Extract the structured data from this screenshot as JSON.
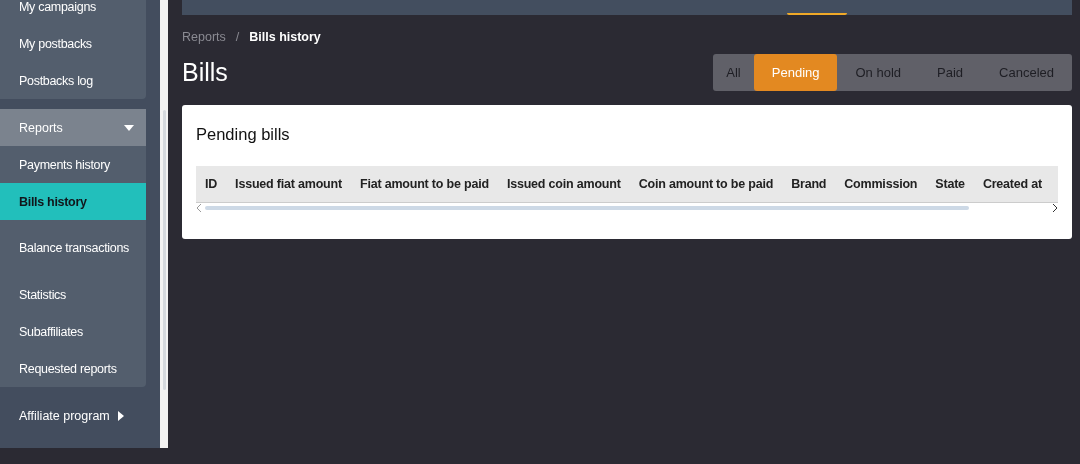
{
  "sidebar": {
    "groups": [
      {
        "items": [
          {
            "label": "My campaigns",
            "selected": false
          },
          {
            "label": "My postbacks",
            "selected": false
          },
          {
            "label": "Postbacks log",
            "selected": false
          }
        ]
      },
      {
        "header": {
          "label": "Reports",
          "expanded": true
        },
        "items": [
          {
            "label": "Payments history",
            "selected": false
          },
          {
            "label": "Bills history",
            "selected": true
          },
          {
            "label": "Balance transactions",
            "selected": false
          },
          {
            "label": "Statistics",
            "selected": false
          },
          {
            "label": "Subaffiliates",
            "selected": false
          },
          {
            "label": "Requested reports",
            "selected": false
          }
        ]
      }
    ],
    "collapsed_item": {
      "label": "Affiliate program",
      "expanded": false
    }
  },
  "breadcrumb_separator": "/",
  "breadcrumb": [
    {
      "label": "Reports",
      "current": false
    },
    {
      "label": "Bills history",
      "current": true
    }
  ],
  "page_title": "Bills",
  "filters": [
    {
      "label": "All",
      "selected": false
    },
    {
      "label": "Pending",
      "selected": true
    },
    {
      "label": "On hold",
      "selected": false
    },
    {
      "label": "Paid",
      "selected": false
    },
    {
      "label": "Canceled",
      "selected": false
    }
  ],
  "card": {
    "title": "Pending bills",
    "table": {
      "columns": [
        "ID",
        "Issued fiat amount",
        "Fiat amount to be paid",
        "Issued coin amount",
        "Coin amount to be paid",
        "Brand",
        "Commission",
        "State",
        "Created at"
      ]
    }
  }
}
